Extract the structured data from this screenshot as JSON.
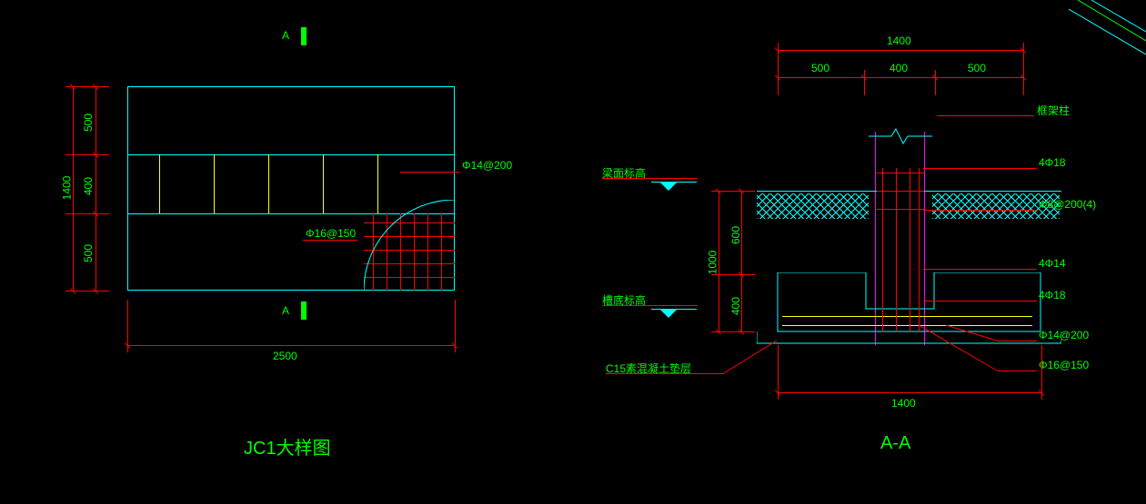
{
  "left_view": {
    "title": "JC1大样图",
    "section_label_top": "A",
    "section_label_bottom": "A",
    "dims": {
      "total_width": "2500",
      "total_height": "1400",
      "row_top": "500",
      "row_mid": "400",
      "row_bot": "500"
    },
    "rebar": {
      "top_label": "Φ14@200",
      "mid_label": "Φ16@150"
    }
  },
  "right_view": {
    "title": "A-A",
    "dims": {
      "top_total": "1400",
      "top_seg1": "500",
      "top_seg2": "400",
      "top_seg3": "500",
      "side_total": "1000",
      "side_seg1": "600",
      "side_seg2": "400",
      "bottom_total": "1400"
    },
    "labels": {
      "col": "框架柱",
      "beam_level": "梁面标高",
      "base_level": "槽底标高",
      "blinding": "C15素混凝土垫层"
    },
    "rebar": {
      "r1": "4Φ18",
      "r2": "Φ8@200(4)",
      "r3": "4Φ14",
      "r4": "4Φ18",
      "r5": "Φ14@200",
      "r6": "Φ16@150"
    }
  },
  "chart_data": {
    "type": "table",
    "description": "CAD structural foundation detail and A-A section",
    "plan_view": {
      "name": "JC1大样图",
      "footing_width_mm": 2500,
      "footing_height_mm": 1400,
      "height_breakdown_mm": [
        500,
        400,
        500
      ],
      "rebar": [
        {
          "label": "Φ14@200",
          "direction": "plan-top-edge"
        },
        {
          "label": "Φ16@150",
          "direction": "plan-middle"
        }
      ]
    },
    "section_view": {
      "name": "A-A",
      "footing_width_mm": 1400,
      "column_zone_mm": [
        500,
        400,
        500
      ],
      "pedestal_depth_mm": 1000,
      "pedestal_breakdown_mm": [
        600,
        400
      ],
      "datum_levels": [
        "梁面标高",
        "槽底标高"
      ],
      "blinding": "C15素混凝土垫层",
      "rebar_callouts": [
        "4Φ18",
        "Φ8@200(4)",
        "4Φ14",
        "4Φ18",
        "Φ14@200",
        "Φ16@150"
      ]
    }
  }
}
